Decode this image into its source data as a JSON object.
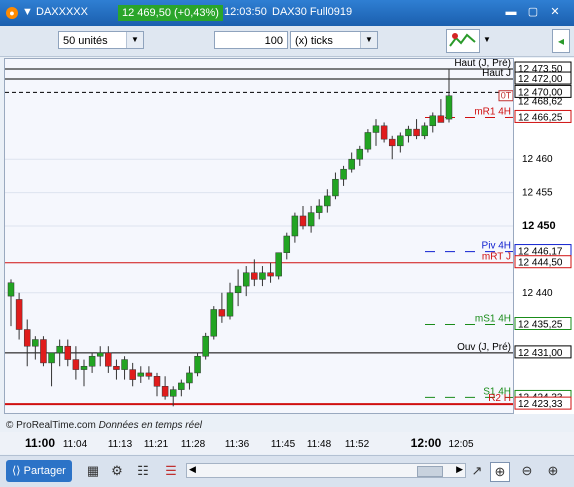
{
  "title_bar": {
    "symbol": "DAXXXXX",
    "price": "12 469,50 (+0,43%)",
    "time": "12:03:50",
    "instrument": "DAX30 Full0919"
  },
  "toolbar": {
    "units_value": "50 unités",
    "quantity_value": "100",
    "ticks_value": "(x) ticks"
  },
  "chart_data": {
    "type": "candlestick",
    "y_ticks": [
      "12 473,50",
      "12 472,00",
      "12 470,00",
      "12 468,62",
      "12 466,25",
      "12 460",
      "12 455",
      "12 450",
      "12 446,17",
      "12 444,50",
      "12 440",
      "12 435,25",
      "12 431,00",
      "12 424,33",
      "12 423,33"
    ],
    "x_ticks": [
      "11:00",
      "11:04",
      "11:13",
      "11:21",
      "11:28",
      "11:36",
      "11:45",
      "11:48",
      "11:52",
      "12:00",
      "12:05"
    ],
    "ylim": [
      12422,
      12475
    ],
    "candles": [
      {
        "o": 12439.5,
        "h": 12442,
        "l": 12435,
        "c": 12441.5
      },
      {
        "o": 12439,
        "h": 12440,
        "l": 12433,
        "c": 12434.5
      },
      {
        "o": 12434.5,
        "h": 12436,
        "l": 12429,
        "c": 12432
      },
      {
        "o": 12432,
        "h": 12433.5,
        "l": 12430,
        "c": 12433
      },
      {
        "o": 12433,
        "h": 12433.5,
        "l": 12429,
        "c": 12429.5
      },
      {
        "o": 12429.5,
        "h": 12431,
        "l": 12426,
        "c": 12431
      },
      {
        "o": 12431,
        "h": 12433,
        "l": 12429,
        "c": 12432
      },
      {
        "o": 12432,
        "h": 12433,
        "l": 12429,
        "c": 12430
      },
      {
        "o": 12430,
        "h": 12432,
        "l": 12427,
        "c": 12428.5
      },
      {
        "o": 12428.5,
        "h": 12430,
        "l": 12426,
        "c": 12429
      },
      {
        "o": 12429,
        "h": 12431,
        "l": 12428,
        "c": 12430.5
      },
      {
        "o": 12430.5,
        "h": 12432,
        "l": 12429,
        "c": 12431
      },
      {
        "o": 12431,
        "h": 12432,
        "l": 12428,
        "c": 12429
      },
      {
        "o": 12429,
        "h": 12430,
        "l": 12427,
        "c": 12428.5
      },
      {
        "o": 12428.5,
        "h": 12430.5,
        "l": 12427,
        "c": 12430
      },
      {
        "o": 12428.5,
        "h": 12429.5,
        "l": 12426,
        "c": 12427
      },
      {
        "o": 12427.5,
        "h": 12429,
        "l": 12426.5,
        "c": 12428
      },
      {
        "o": 12428,
        "h": 12429,
        "l": 12427,
        "c": 12427.5
      },
      {
        "o": 12427.5,
        "h": 12428,
        "l": 12424.5,
        "c": 12426
      },
      {
        "o": 12426,
        "h": 12427.5,
        "l": 12424,
        "c": 12424.5
      },
      {
        "o": 12424.5,
        "h": 12426,
        "l": 12423,
        "c": 12425.5
      },
      {
        "o": 12425.5,
        "h": 12427,
        "l": 12424.5,
        "c": 12426.5
      },
      {
        "o": 12426.5,
        "h": 12429,
        "l": 12425.5,
        "c": 12428
      },
      {
        "o": 12428,
        "h": 12431,
        "l": 12427.5,
        "c": 12430.5
      },
      {
        "o": 12430.5,
        "h": 12434,
        "l": 12430,
        "c": 12433.5
      },
      {
        "o": 12433.5,
        "h": 12438,
        "l": 12433,
        "c": 12437.5
      },
      {
        "o": 12437.5,
        "h": 12440,
        "l": 12435.5,
        "c": 12436.5
      },
      {
        "o": 12436.5,
        "h": 12441.5,
        "l": 12436,
        "c": 12440
      },
      {
        "o": 12440,
        "h": 12443.5,
        "l": 12438,
        "c": 12441
      },
      {
        "o": 12441,
        "h": 12444,
        "l": 12439.5,
        "c": 12443
      },
      {
        "o": 12443,
        "h": 12445,
        "l": 12441,
        "c": 12442
      },
      {
        "o": 12442,
        "h": 12444,
        "l": 12441,
        "c": 12443
      },
      {
        "o": 12443,
        "h": 12444.5,
        "l": 12441.5,
        "c": 12442.5
      },
      {
        "o": 12442.5,
        "h": 12446,
        "l": 12442,
        "c": 12446
      },
      {
        "o": 12446,
        "h": 12449,
        "l": 12445,
        "c": 12448.5
      },
      {
        "o": 12448.5,
        "h": 12452,
        "l": 12447.5,
        "c": 12451.5
      },
      {
        "o": 12451.5,
        "h": 12453,
        "l": 12449.5,
        "c": 12450
      },
      {
        "o": 12450,
        "h": 12453,
        "l": 12449,
        "c": 12452
      },
      {
        "o": 12452,
        "h": 12454,
        "l": 12451,
        "c": 12453
      },
      {
        "o": 12453,
        "h": 12455.5,
        "l": 12452,
        "c": 12454.5
      },
      {
        "o": 12454.5,
        "h": 12458,
        "l": 12454,
        "c": 12457
      },
      {
        "o": 12457,
        "h": 12459,
        "l": 12456,
        "c": 12458.5
      },
      {
        "o": 12458.5,
        "h": 12461,
        "l": 12458,
        "c": 12460
      },
      {
        "o": 12460,
        "h": 12462,
        "l": 12459,
        "c": 12461.5
      },
      {
        "o": 12461.5,
        "h": 12464.5,
        "l": 12461,
        "c": 12464
      },
      {
        "o": 12464,
        "h": 12466,
        "l": 12462,
        "c": 12465
      },
      {
        "o": 12465,
        "h": 12465.5,
        "l": 12462.5,
        "c": 12463
      },
      {
        "o": 12463,
        "h": 12463.5,
        "l": 12460,
        "c": 12462
      },
      {
        "o": 12462,
        "h": 12464,
        "l": 12461,
        "c": 12463.5
      },
      {
        "o": 12463.5,
        "h": 12465,
        "l": 12462.5,
        "c": 12464.5
      },
      {
        "o": 12464.5,
        "h": 12466,
        "l": 12463,
        "c": 12463.5
      },
      {
        "o": 12463.5,
        "h": 12465.5,
        "l": 12463,
        "c": 12465
      },
      {
        "o": 12465,
        "h": 12467,
        "l": 12464,
        "c": 12466.5
      },
      {
        "o": 12466.5,
        "h": 12469,
        "l": 12465.5,
        "c": 12465.5
      },
      {
        "o": 12466,
        "h": 12473.5,
        "l": 12465.5,
        "c": 12469.5
      }
    ],
    "levels": [
      {
        "label": "Haut (J, Pré)",
        "value": 12473.5,
        "color": "#000000",
        "axis_label": "12 473,50",
        "style": "solid"
      },
      {
        "label": "Haut J",
        "value": 12472.0,
        "color": "#000000",
        "axis_label": "12 472,00",
        "style": "solid"
      },
      {
        "label": "",
        "value": 12470.0,
        "color": "#000000",
        "axis_label": "12 470,00",
        "style": "dashed"
      },
      {
        "label": "",
        "value": 12468.62,
        "color": "#000000",
        "axis_label": "12 468,62",
        "style": "none"
      },
      {
        "label": "mR1 4H",
        "value": 12466.25,
        "color": "#d01010",
        "axis_label": "12 466,25",
        "style": "dash-right"
      },
      {
        "label": "Piv 4H",
        "value": 12446.17,
        "color": "#1020d0",
        "axis_label": "12 446,17",
        "style": "dash-right"
      },
      {
        "label": "mRT J",
        "value": 12444.5,
        "color": "#d01010",
        "axis_label": "12 444,50",
        "style": "solid"
      },
      {
        "label": "mS1 4H",
        "value": 12435.25,
        "color": "#1a8c1a",
        "axis_label": "12 435,25",
        "style": "dash-right"
      },
      {
        "label": "Ouv (J, Pré)",
        "value": 12431.0,
        "color": "#000000",
        "axis_label": "12 431,00",
        "style": "solid"
      },
      {
        "label": "S1 4H",
        "value": 12424.33,
        "color": "#1a8c1a",
        "axis_label": "12 424,33",
        "style": "dash-right"
      },
      {
        "label": "R2 H",
        "value": 12423.33,
        "color": "#d01010",
        "axis_label": "12 423,33",
        "style": "solid-thick"
      }
    ],
    "current_marker": "0T",
    "colors": {
      "up": "#22a422",
      "down": "#e01c1c",
      "background": "#f5f7fd"
    }
  },
  "legend_text": {
    "copyright": "© ProRealTime.com",
    "realtime": "Données en temps réel"
  },
  "bottom_bar": {
    "share_label": "Partager"
  }
}
